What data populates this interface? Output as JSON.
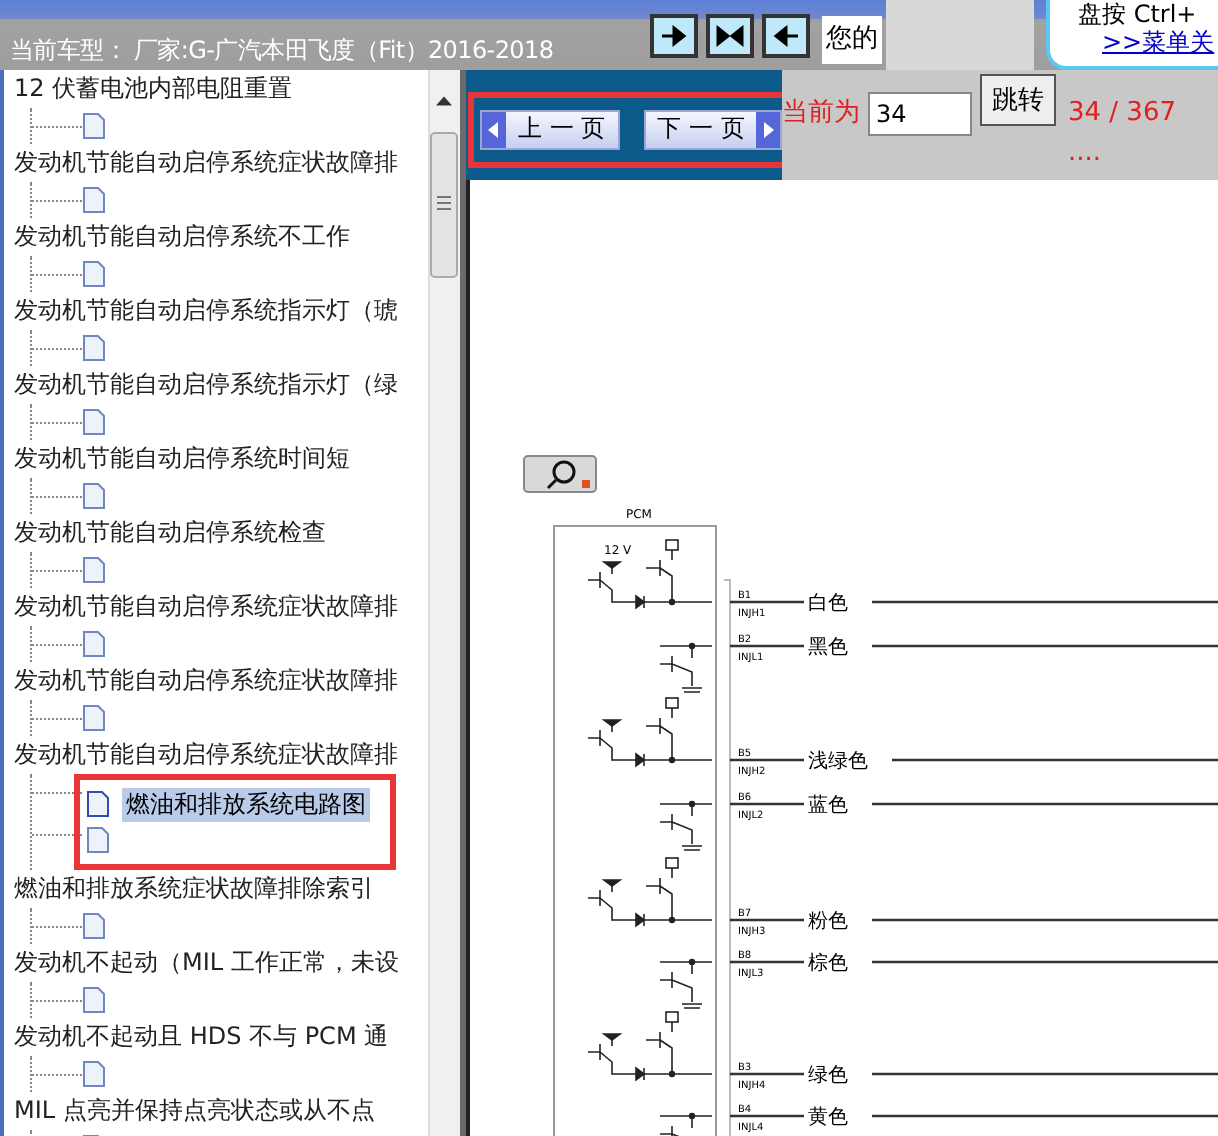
{
  "header": {
    "title": "当前车型： 厂家:G-广汽本田飞度（Fit）2016-2018",
    "toolbar": [
      {
        "kind": "right"
      },
      {
        "kind": "both"
      },
      {
        "kind": "left"
      }
    ],
    "greeting": "您的",
    "ad": {
      "text": "盘按 Ctrl+",
      "link": ">>菜单关"
    }
  },
  "tree": {
    "items": [
      {
        "label": "12 伏蓄电池内部电阻重置",
        "highlighted": false,
        "children": [
          {
            "selected": false
          }
        ]
      },
      {
        "label": "发动机节能自动启停系统症状故障排",
        "highlighted": false,
        "children": [
          {
            "selected": false
          }
        ]
      },
      {
        "label": "发动机节能自动启停系统不工作",
        "highlighted": false,
        "children": [
          {
            "selected": false
          }
        ]
      },
      {
        "label": "发动机节能自动启停系统指示灯（琥",
        "highlighted": false,
        "children": [
          {
            "selected": false
          }
        ]
      },
      {
        "label": "发动机节能自动启停系统指示灯（绿",
        "highlighted": false,
        "children": [
          {
            "selected": false
          }
        ]
      },
      {
        "label": "发动机节能自动启停系统时间短",
        "highlighted": false,
        "children": [
          {
            "selected": false
          }
        ]
      },
      {
        "label": "发动机节能自动启停系统检查",
        "highlighted": false,
        "children": [
          {
            "selected": false
          }
        ]
      },
      {
        "label": "发动机节能自动启停系统症状故障排",
        "highlighted": false,
        "children": [
          {
            "selected": false
          }
        ]
      },
      {
        "label": "发动机节能自动启停系统症状故障排",
        "highlighted": false,
        "children": [
          {
            "selected": false
          }
        ]
      },
      {
        "label": "发动机节能自动启停系统症状故障排",
        "highlighted": true,
        "children": [
          {
            "label": "燃油和排放系统电路图",
            "selected": true
          },
          {
            "selected": false
          }
        ]
      },
      {
        "label": "燃油和排放系统症状故障排除索引",
        "highlighted": false,
        "children": [
          {
            "selected": false
          }
        ]
      },
      {
        "label": "发动机不起动（MIL 工作正常，未设",
        "highlighted": false,
        "children": [
          {
            "selected": false
          }
        ]
      },
      {
        "label": "发动机不起动且 HDS 不与 PCM 通",
        "highlighted": false,
        "children": [
          {
            "selected": false
          }
        ]
      },
      {
        "label": "MIL 点亮并保持点亮状态或从不点",
        "highlighted": false,
        "children": [
          {
            "selected": false
          }
        ]
      }
    ]
  },
  "pager": {
    "highlighted": true,
    "prev": "上 一 页",
    "next": "下 一 页",
    "page_label": "当前为",
    "page_input": "34",
    "go": "跳转",
    "page_count": "34 / 367 ...."
  },
  "diagram": {
    "module": "PCM",
    "voltage": "12 V",
    "circuits": [
      {
        "kind": "high",
        "pin": "B1",
        "signal": "INJH1",
        "wire": "白色"
      },
      {
        "kind": "low",
        "pin": "B2",
        "signal": "INJL1",
        "wire": "黑色"
      },
      {
        "kind": "high",
        "pin": "B5",
        "signal": "INJH2",
        "wire": "浅绿色"
      },
      {
        "kind": "low",
        "pin": "B6",
        "signal": "INJL2",
        "wire": "蓝色"
      },
      {
        "kind": "high",
        "pin": "B7",
        "signal": "INJH3",
        "wire": "粉色"
      },
      {
        "kind": "low",
        "pin": "B8",
        "signal": "INJL3",
        "wire": "棕色"
      },
      {
        "kind": "high",
        "pin": "B3",
        "signal": "INJH4",
        "wire": "绿色"
      },
      {
        "kind": "low",
        "pin": "B4",
        "signal": "INJL4",
        "wire": "黄色"
      }
    ]
  }
}
